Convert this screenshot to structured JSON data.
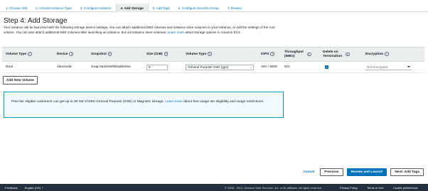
{
  "steps": [
    "1. Choose AMI",
    "2. Choose Instance Type",
    "3. Configure Instance",
    "4. Add Storage",
    "5. Add Tags",
    "6. Configure Security Group",
    "7. Review"
  ],
  "active_step": 3,
  "title": "Step 4: Add Storage",
  "intro": {
    "text": "Your instance will be launched with the following storage device settings. You can attach additional EBS volumes and instance store volumes to your instance, or edit the settings of the root volume. You can also attach additional EBS volumes after launching an instance, but not instance store volumes.",
    "learn_more": "Learn more",
    "text_after": "about storage options in Amazon EC2."
  },
  "table": {
    "headers": {
      "volume_type": "Volume Type",
      "device": "Device",
      "snapshot": "Snapshot",
      "size": "Size (GiB)",
      "vol_type": "Volume Type",
      "iops": "IOPS",
      "throughput": "Throughput (MB/s)",
      "delete": "Delete on Termination",
      "encryption": "Encryption"
    },
    "row": {
      "volume_type": "Root",
      "device": "/dev/xvda",
      "snapshot": "snap-0a4cb9ef00ad8ee5e",
      "size": "8",
      "vol_type": "General Purpose SSD (gp2)",
      "iops": "100 / 3000",
      "throughput": "N/A",
      "delete_checked": true,
      "encryption": "Not Encrypted"
    }
  },
  "add_volume_label": "Add New Volume",
  "info_box": {
    "text": "Free tier eligible customers can get up to 30 GB of EBS General Purpose (SSD) or Magnetic storage.",
    "learn_more": "Learn more",
    "text_after": "about free usage tier eligibility and usage restrictions."
  },
  "actions": {
    "cancel": "Cancel",
    "previous": "Previous",
    "review_launch": "Review and Launch",
    "next": "Next: Add Tags"
  },
  "footer": {
    "feedback": "Feedback",
    "language": "English (US)",
    "copyright": "© 2008 - 2021, Amazon Web Services, Inc. or its affiliates. All rights reserved.",
    "privacy": "Privacy Policy",
    "terms": "Terms of Use",
    "cookies": "Cookie preferences"
  },
  "icons": {
    "info": "info-icon",
    "checkbox": "checkmark-icon",
    "select": "chevron-down-icon",
    "caret": "caret-down-icon"
  },
  "colors": {
    "link": "#0073bb",
    "primary": "#0073bb",
    "footer_bg": "#232f3e",
    "info_border": "#00a1c9",
    "info_bg": "#f1faff"
  }
}
